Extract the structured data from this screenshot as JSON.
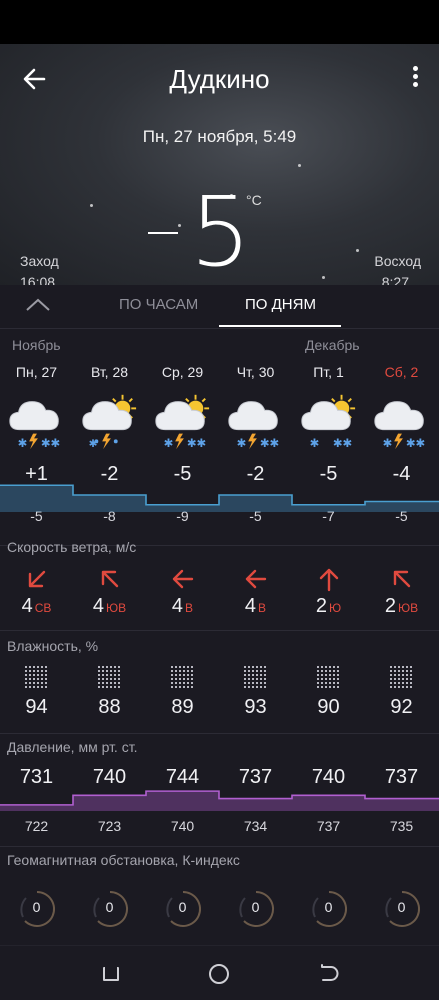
{
  "header": {
    "city": "Дудкино",
    "datetime": "Пн, 27 ноября, 5:49",
    "temperature": "5",
    "unit": "°C",
    "sunset_label": "Заход",
    "sunset_time": "16:08",
    "sunrise_label": "Восход",
    "sunrise_time": "8:27"
  },
  "tabs": {
    "hourly": "ПО ЧАСАМ",
    "daily": "ПО ДНЯМ",
    "selected": "daily"
  },
  "months": [
    "Ноябрь",
    "Декабрь"
  ],
  "days": [
    {
      "label": "Пн, 27",
      "weekend": false,
      "icon": "cloud-thunder-snow-icon",
      "hi": "+1",
      "lo": "-5",
      "wind_speed": "4",
      "wind_dir": "СВ",
      "wind_icon": "arrow-down-left-icon",
      "humidity": "94",
      "pres_hi": "731",
      "pres_lo": "722",
      "kp": "0"
    },
    {
      "label": "Вт, 28",
      "weekend": false,
      "icon": "sun-cloud-thunder-rain-icon",
      "hi": "-2",
      "lo": "-8",
      "wind_speed": "4",
      "wind_dir": "ЮВ",
      "wind_icon": "arrow-up-left-icon",
      "humidity": "88",
      "pres_hi": "740",
      "pres_lo": "723",
      "kp": "0"
    },
    {
      "label": "Ср, 29",
      "weekend": false,
      "icon": "sun-cloud-thunder-snow-icon",
      "hi": "-5",
      "lo": "-9",
      "wind_speed": "4",
      "wind_dir": "В",
      "wind_icon": "arrow-left-icon",
      "humidity": "89",
      "pres_hi": "744",
      "pres_lo": "740",
      "kp": "0"
    },
    {
      "label": "Чт, 30",
      "weekend": false,
      "icon": "cloud-thunder-snow-icon",
      "hi": "-2",
      "lo": "-5",
      "wind_speed": "4",
      "wind_dir": "В",
      "wind_icon": "arrow-left-icon",
      "humidity": "93",
      "pres_hi": "737",
      "pres_lo": "734",
      "kp": "0"
    },
    {
      "label": "Пт, 1",
      "weekend": false,
      "icon": "sun-cloud-snow-icon",
      "hi": "-5",
      "lo": "-7",
      "wind_speed": "2",
      "wind_dir": "Ю",
      "wind_icon": "arrow-up-icon",
      "humidity": "90",
      "pres_hi": "740",
      "pres_lo": "737",
      "kp": "0"
    },
    {
      "label": "Сб, 2",
      "weekend": true,
      "icon": "cloud-thunder-snow-icon",
      "hi": "-4",
      "lo": "-5",
      "wind_speed": "2",
      "wind_dir": "ЮВ",
      "wind_icon": "arrow-up-left-icon",
      "humidity": "92",
      "pres_hi": "737",
      "pres_lo": "735",
      "kp": "0"
    }
  ],
  "sections": {
    "wind": "Скорость ветра, м/с",
    "humidity": "Влажность, %",
    "pressure": "Давление, мм рт. ст.",
    "geomagnetic": "Геомагнитная обстановка, К-индекс"
  },
  "colors": {
    "background": "#1b1a22",
    "temp_chart": "#4a9fd0",
    "pressure_chart": "#b15fd0",
    "weekend": "#e04a3f",
    "wind_arrow": "#e04a3f"
  }
}
